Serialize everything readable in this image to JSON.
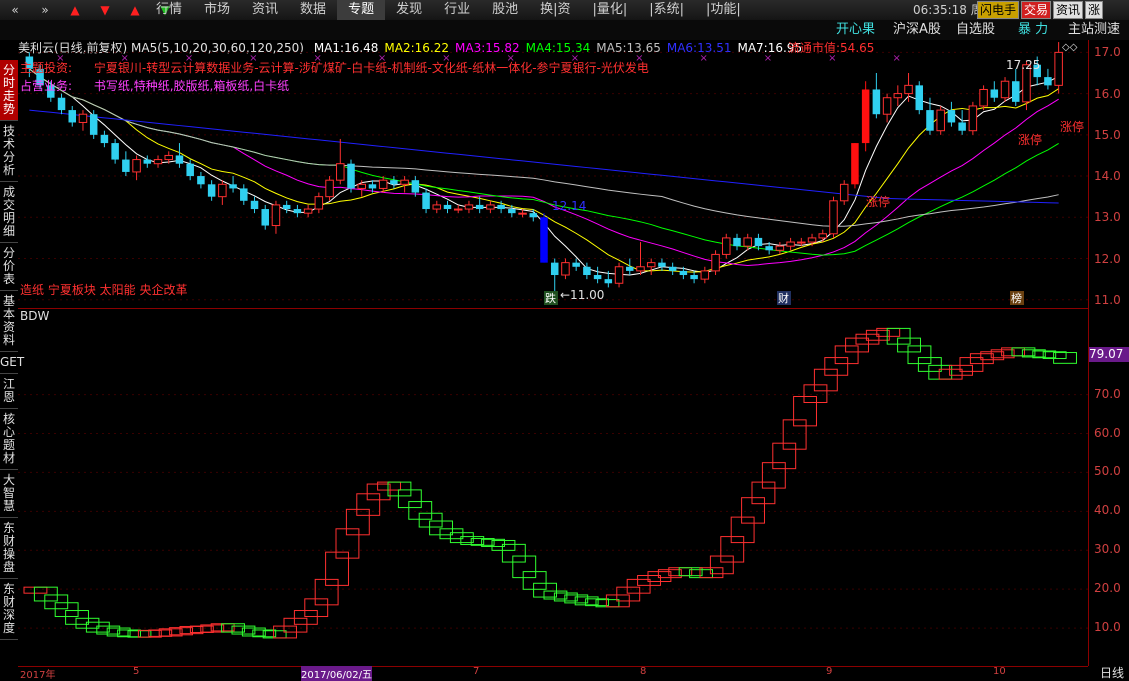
{
  "topbar": {
    "nav_icons": [
      "double-left",
      "double-right",
      "up-red",
      "down-red",
      "up-red",
      "down-green"
    ],
    "menu": [
      "行情",
      "市场",
      "资讯",
      "数据",
      "专题",
      "发现",
      "行业",
      "股池",
      "换|资",
      "|量化|",
      "|系统|",
      "|功能|"
    ],
    "active_menu": "专题",
    "time": "06:35:18",
    "weekday": "周五",
    "buttons": [
      "闪电手",
      "交易",
      "资讯",
      "涨"
    ]
  },
  "subbar": {
    "items": [
      "开心果",
      "沪深A股",
      "自选股",
      "暴 力",
      "主站测速"
    ]
  },
  "sidebar": [
    "分时走势",
    "技术分析",
    "成交明细",
    "分价表",
    "基本资料",
    "GET",
    "江恩",
    "核心题材",
    "大智慧",
    "东财操盘",
    "东财深度"
  ],
  "sidebar_active": "分时走势",
  "chart_header": {
    "name": "美利云(日线,前复权)",
    "ma_params": "MA5(5,10,20,30,60,120,250)",
    "ma": [
      {
        "label": "MA1:",
        "value": "16.48",
        "color": "#ffffff"
      },
      {
        "label": "MA2:",
        "value": "16.22",
        "color": "#ffff00"
      },
      {
        "label": "MA3:",
        "value": "15.82",
        "color": "#ff00ff"
      },
      {
        "label": "MA4:",
        "value": "15.34",
        "color": "#00ff00"
      },
      {
        "label": "MA5:",
        "value": "13.65",
        "color": "#c0c0c0"
      },
      {
        "label": "MA6:",
        "value": "13.51",
        "color": "#3030ff"
      },
      {
        "label": "MA7:",
        "value": "16.95",
        "color": "#ffffff"
      }
    ],
    "market_cap_label": "流通市值:",
    "market_cap_value": "54.65"
  },
  "annotations": {
    "topic_label": "主题投资:",
    "topic_text": "宁夏银川-转型云计算数据业务-云计算-涉矿煤矿-白卡纸-机制纸-文化纸-纸林一体化-参宁夏银行-光伏发电",
    "product_label": "占营业务:",
    "product_text": "书写纸,特种纸,胶版纸,箱板纸,白卡纸",
    "concept_text": "造纸 宁夏板块 太阳能 央企改革",
    "low_label": "←11.00",
    "high_label": "17.25",
    "limit_up_1": "涨停",
    "limit_up_2": "涨停",
    "limit_up_3": "涨停",
    "markers": [
      "跌",
      "财",
      "榜"
    ],
    "vol_tag": "12.14"
  },
  "indicator": {
    "name": "BDW",
    "last_value": "79.07"
  },
  "axis_main": [
    "17.0",
    "16.0",
    "15.0",
    "14.0",
    "13.0",
    "12.0",
    "11.0"
  ],
  "axis_indi": [
    "70.0",
    "60.0",
    "50.0",
    "40.0",
    "30.0",
    "20.0",
    "10.0"
  ],
  "bottom_dates": [
    "2017年",
    "5",
    "2017/06/02/五",
    "7",
    "8",
    "9",
    "10"
  ],
  "bottom_right": "日线",
  "chart_data": {
    "type": "candlestick",
    "ylim": [
      10.8,
      17.3
    ],
    "ohlc": [
      [
        16.9,
        17.0,
        16.4,
        16.6
      ],
      [
        16.6,
        16.7,
        16.1,
        16.2
      ],
      [
        16.2,
        16.3,
        15.8,
        15.9
      ],
      [
        15.9,
        16.0,
        15.5,
        15.6
      ],
      [
        15.6,
        15.7,
        15.2,
        15.3
      ],
      [
        15.3,
        15.6,
        15.1,
        15.5
      ],
      [
        15.5,
        15.6,
        14.9,
        15.0
      ],
      [
        15.0,
        15.1,
        14.7,
        14.8
      ],
      [
        14.8,
        14.9,
        14.3,
        14.4
      ],
      [
        14.4,
        14.6,
        14.0,
        14.1
      ],
      [
        14.1,
        14.5,
        13.9,
        14.4
      ],
      [
        14.4,
        14.5,
        14.2,
        14.3
      ],
      [
        14.3,
        14.5,
        14.2,
        14.4
      ],
      [
        14.4,
        14.6,
        14.3,
        14.5
      ],
      [
        14.5,
        14.8,
        14.2,
        14.3
      ],
      [
        14.3,
        14.4,
        13.9,
        14.0
      ],
      [
        14.0,
        14.1,
        13.7,
        13.8
      ],
      [
        13.8,
        13.9,
        13.4,
        13.5
      ],
      [
        13.5,
        13.9,
        13.3,
        13.8
      ],
      [
        13.8,
        14.0,
        13.6,
        13.7
      ],
      [
        13.7,
        13.8,
        13.3,
        13.4
      ],
      [
        13.4,
        13.5,
        13.1,
        13.2
      ],
      [
        13.2,
        13.3,
        12.7,
        12.8
      ],
      [
        12.8,
        13.4,
        12.6,
        13.3
      ],
      [
        13.3,
        13.4,
        13.1,
        13.2
      ],
      [
        13.2,
        13.3,
        13.0,
        13.1
      ],
      [
        13.1,
        13.3,
        13.0,
        13.2
      ],
      [
        13.2,
        13.6,
        13.1,
        13.5
      ],
      [
        13.5,
        14.0,
        13.4,
        13.9
      ],
      [
        13.9,
        14.9,
        13.8,
        14.3
      ],
      [
        14.3,
        14.4,
        13.6,
        13.7
      ],
      [
        13.7,
        13.9,
        13.5,
        13.8
      ],
      [
        13.8,
        13.9,
        13.6,
        13.7
      ],
      [
        13.7,
        14.0,
        13.6,
        13.9
      ],
      [
        13.9,
        14.0,
        13.7,
        13.8
      ],
      [
        13.8,
        14.0,
        13.6,
        13.9
      ],
      [
        13.9,
        14.0,
        13.5,
        13.6
      ],
      [
        13.6,
        13.7,
        13.1,
        13.2
      ],
      [
        13.2,
        13.4,
        13.1,
        13.3
      ],
      [
        13.3,
        13.4,
        13.1,
        13.2
      ],
      [
        13.2,
        13.3,
        13.1,
        13.2
      ],
      [
        13.2,
        13.4,
        13.1,
        13.3
      ],
      [
        13.3,
        13.5,
        13.1,
        13.2
      ],
      [
        13.2,
        13.4,
        13.1,
        13.3
      ],
      [
        13.3,
        13.4,
        13.1,
        13.2
      ],
      [
        13.2,
        13.3,
        13.0,
        13.1
      ],
      [
        13.1,
        13.2,
        13.0,
        13.1
      ],
      [
        13.1,
        13.2,
        12.9,
        13.0
      ],
      [
        13.0,
        13.1,
        11.9,
        11.9
      ],
      [
        11.9,
        12.0,
        11.0,
        11.6
      ],
      [
        11.6,
        12.0,
        11.5,
        11.9
      ],
      [
        11.9,
        12.0,
        11.7,
        11.8
      ],
      [
        11.8,
        11.9,
        11.5,
        11.6
      ],
      [
        11.6,
        11.8,
        11.4,
        11.5
      ],
      [
        11.5,
        11.7,
        11.3,
        11.4
      ],
      [
        11.4,
        11.9,
        11.3,
        11.8
      ],
      [
        11.8,
        12.0,
        11.6,
        11.7
      ],
      [
        11.7,
        12.4,
        11.6,
        11.8
      ],
      [
        11.8,
        12.0,
        11.6,
        11.9
      ],
      [
        11.9,
        12.0,
        11.7,
        11.8
      ],
      [
        11.8,
        11.9,
        11.6,
        11.7
      ],
      [
        11.7,
        11.8,
        11.5,
        11.6
      ],
      [
        11.6,
        11.7,
        11.4,
        11.5
      ],
      [
        11.5,
        11.8,
        11.4,
        11.7
      ],
      [
        11.7,
        12.2,
        11.6,
        12.1
      ],
      [
        12.1,
        12.6,
        12.0,
        12.5
      ],
      [
        12.5,
        12.6,
        12.2,
        12.3
      ],
      [
        12.3,
        12.6,
        12.2,
        12.5
      ],
      [
        12.5,
        12.6,
        12.2,
        12.3
      ],
      [
        12.3,
        12.4,
        12.1,
        12.2
      ],
      [
        12.2,
        12.4,
        12.1,
        12.3
      ],
      [
        12.3,
        12.5,
        12.2,
        12.4
      ],
      [
        12.4,
        12.5,
        12.3,
        12.4
      ],
      [
        12.4,
        12.6,
        12.3,
        12.5
      ],
      [
        12.5,
        12.7,
        12.4,
        12.6
      ],
      [
        12.6,
        13.5,
        12.5,
        13.4
      ],
      [
        13.4,
        13.9,
        13.3,
        13.8
      ],
      [
        13.8,
        14.8,
        13.7,
        14.8
      ],
      [
        14.8,
        16.3,
        14.6,
        16.1
      ],
      [
        16.1,
        16.5,
        15.4,
        15.5
      ],
      [
        15.5,
        16.0,
        15.3,
        15.9
      ],
      [
        15.9,
        16.2,
        15.7,
        16.0
      ],
      [
        16.0,
        16.5,
        15.8,
        16.2
      ],
      [
        16.2,
        16.3,
        15.5,
        15.6
      ],
      [
        15.6,
        15.9,
        15.0,
        15.1
      ],
      [
        15.1,
        15.7,
        15.0,
        15.6
      ],
      [
        15.6,
        15.8,
        15.2,
        15.3
      ],
      [
        15.3,
        15.6,
        15.0,
        15.1
      ],
      [
        15.1,
        15.8,
        15.0,
        15.7
      ],
      [
        15.7,
        16.2,
        15.6,
        16.1
      ],
      [
        16.1,
        16.3,
        15.8,
        15.9
      ],
      [
        15.9,
        16.4,
        15.8,
        16.3
      ],
      [
        16.3,
        16.6,
        15.7,
        15.8
      ],
      [
        15.8,
        16.8,
        15.6,
        16.7
      ],
      [
        16.7,
        16.9,
        16.2,
        16.4
      ],
      [
        16.4,
        16.6,
        16.1,
        16.2
      ],
      [
        16.2,
        17.25,
        16.0,
        17.0
      ]
    ],
    "indicator_bdw": [
      20,
      18,
      16,
      14,
      12,
      11,
      10,
      9.5,
      9,
      8.8,
      8.7,
      8.9,
      9,
      9.3,
      9.6,
      9.9,
      10,
      10.3,
      10.6,
      10,
      9.5,
      9,
      8.8,
      8.5,
      10,
      12,
      14,
      17,
      22,
      29,
      35,
      40,
      44,
      46.5,
      47,
      45,
      42,
      39,
      37,
      35,
      34,
      33,
      32.5,
      32.3,
      32,
      31,
      28,
      24,
      21,
      19,
      18.5,
      18,
      17.5,
      17,
      16.8,
      16.5,
      18,
      20,
      22,
      23,
      24,
      24.5,
      25,
      24.5,
      24,
      25,
      28,
      33,
      38,
      43,
      47,
      52,
      57,
      63,
      69,
      72,
      76,
      79,
      82,
      84,
      85,
      86,
      86.5,
      84,
      82,
      79,
      77,
      75,
      76,
      77,
      79,
      80,
      80.5,
      81,
      81.5,
      81,
      80.7,
      80.5,
      80.3,
      79.07
    ],
    "ma_series": [
      "MA1",
      "MA2",
      "MA3",
      "MA4",
      "MA5",
      "MA6",
      "MA7"
    ]
  }
}
